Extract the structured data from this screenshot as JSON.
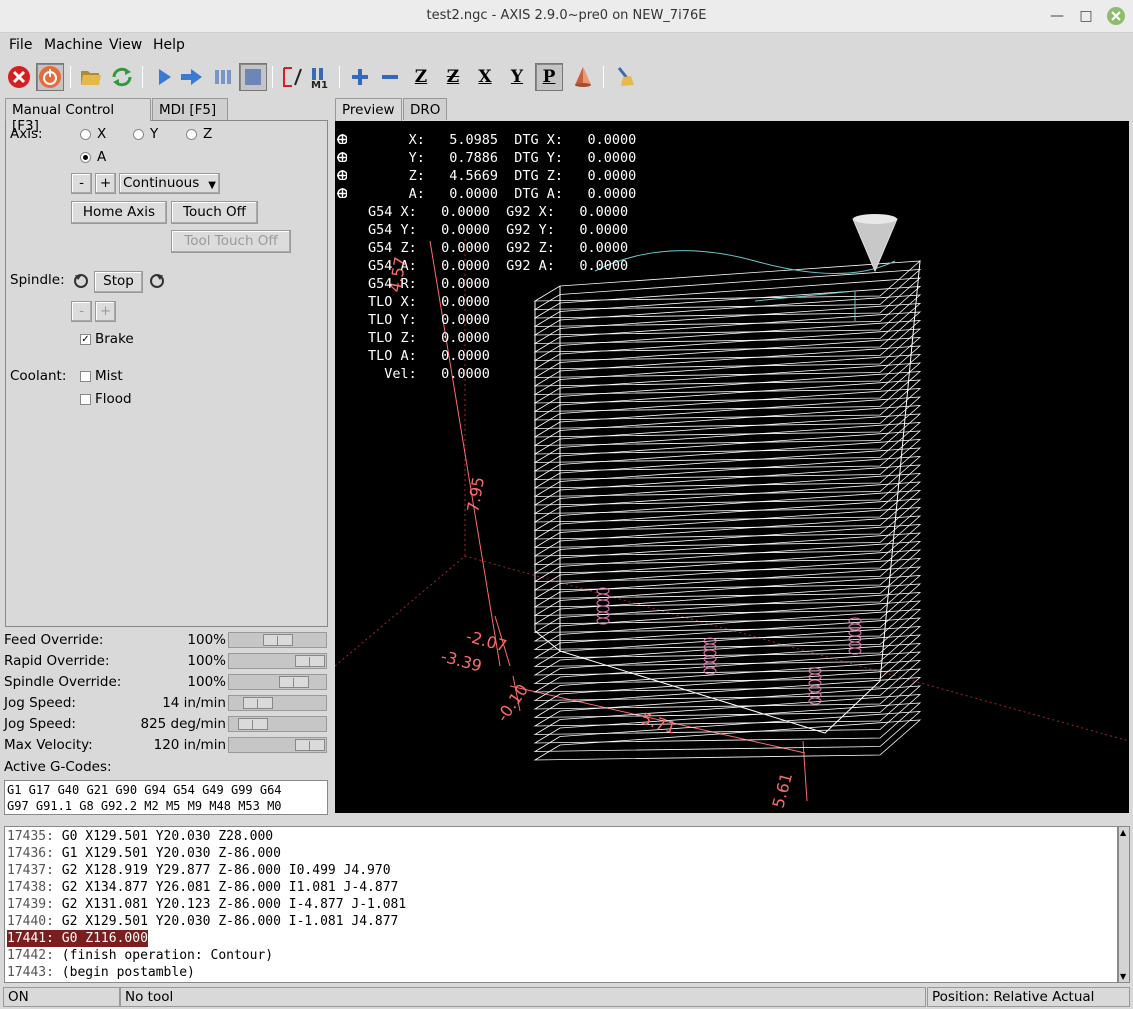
{
  "window": {
    "title": "test2.ngc - AXIS 2.9.0~pre0 on NEW_7i76E"
  },
  "menu": {
    "file": "File",
    "machine": "Machine",
    "view": "View",
    "help": "Help"
  },
  "toolbar": {
    "icons": [
      "estop-icon",
      "power-icon",
      "open-file-icon",
      "reload-icon",
      "run-icon",
      "step-icon",
      "pause-icon",
      "stop-icon",
      "block-delete-icon",
      "optional-stop-icon",
      "zoom-in-icon",
      "zoom-out-icon",
      "view-z-icon",
      "view-z2-icon",
      "view-x-icon",
      "view-y-icon",
      "view-p-icon",
      "rotate-view-icon",
      "clear-plot-icon"
    ],
    "view_labels": {
      "z": "Z",
      "z2": "Z",
      "x": "X",
      "y": "Y",
      "p": "P"
    },
    "m1_label": "M1"
  },
  "left_tabs": {
    "manual": "Manual Control [F3]",
    "mdi": "MDI [F5]"
  },
  "manual": {
    "axis_label": "Axis:",
    "axes": [
      "X",
      "Y",
      "Z",
      "A"
    ],
    "selected_axis": "A",
    "jog_minus": "-",
    "jog_plus": "+",
    "jog_mode": "Continuous",
    "home_axis": "Home Axis",
    "touch_off": "Touch Off",
    "tool_touch_off": "Tool Touch Off",
    "spindle_label": "Spindle:",
    "spindle_stop": "Stop",
    "spindle_minus": "-",
    "spindle_plus": "+",
    "brake_label": "Brake",
    "brake_checked": true,
    "coolant_label": "Coolant:",
    "mist_label": "Mist",
    "flood_label": "Flood"
  },
  "overrides": [
    {
      "label": "Feed Override:",
      "value": "100%",
      "level": 0.5
    },
    {
      "label": "Rapid Override:",
      "value": "100%",
      "level": 1.0
    },
    {
      "label": "Spindle Override:",
      "value": "100%",
      "level": 0.75
    },
    {
      "label": "Jog Speed:",
      "value": "14 in/min",
      "level": 0.2
    },
    {
      "label": "Jog Speed:",
      "value": "825 deg/min",
      "level": 0.12
    },
    {
      "label": "Max Velocity:",
      "value": "120 in/min",
      "level": 1.0
    }
  ],
  "active_gcodes": {
    "label": "Active G-Codes:",
    "line1": "G1 G17 G40 G21 G90 G94 G54 G49 G99 G64",
    "line2": "G97 G91.1 G8 G92.2 M2 M5 M9 M48 M53 M0"
  },
  "right_tabs": {
    "preview": "Preview",
    "dro": "DRO"
  },
  "dro_lines": [
    "     X:   5.0985  DTG X:   0.0000",
    "     Y:   0.7886  DTG Y:   0.0000",
    "     Z:   4.5669  DTG Z:   0.0000",
    "     A:   0.0000  DTG A:   0.0000",
    "G54 X:   0.0000  G92 X:   0.0000",
    "G54 Y:   0.0000  G92 Y:   0.0000",
    "G54 Z:   0.0000  G92 Z:   0.0000",
    "G54 A:   0.0000  G92 A:   0.0000",
    "G54 R:   0.0000",
    "TLO X:   0.0000",
    "TLO Y:   0.0000",
    "TLO Z:   0.0000",
    "TLO A:   0.0000",
    "  Vel:   0.0000"
  ],
  "preview_dims": {
    "z_top": "4.57",
    "z_len": "7.95",
    "z_bot1": "-2.07",
    "z_bot2": "-3.39",
    "x_min": "-0.10",
    "x_len": "5.71",
    "x_max": "5.61"
  },
  "code_lines": [
    {
      "n": "17435:",
      "t": "G0 X129.501 Y20.030 Z28.000"
    },
    {
      "n": "17436:",
      "t": "G1 X129.501 Y20.030 Z-86.000"
    },
    {
      "n": "17437:",
      "t": "G2 X128.919 Y29.877 Z-86.000 I0.499 J4.970"
    },
    {
      "n": "17438:",
      "t": "G2 X134.877 Y26.081 Z-86.000 I1.081 J-4.877"
    },
    {
      "n": "17439:",
      "t": "G2 X131.081 Y20.123 Z-86.000 I-4.877 J-1.081"
    },
    {
      "n": "17440:",
      "t": "G2 X129.501 Y20.030 Z-86.000 I-1.081 J4.877"
    },
    {
      "n": "17441:",
      "t": "G0 Z116.000",
      "highlight": true
    },
    {
      "n": "17442:",
      "t": "(finish operation: Contour)"
    },
    {
      "n": "17443:",
      "t": "(begin postamble)"
    }
  ],
  "status": {
    "state": "ON",
    "tool": "No tool",
    "position": "Position: Relative Actual"
  },
  "colors": {
    "highlight": "#7a1e1e",
    "limits": "#ff6a6a",
    "plot": "#ffffff",
    "tool": "#cccccc"
  }
}
